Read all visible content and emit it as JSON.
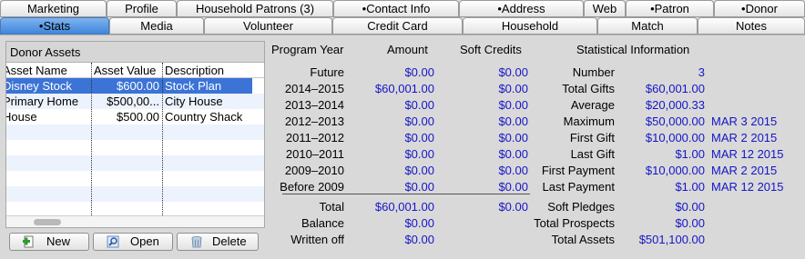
{
  "tabs_row1": [
    "Marketing",
    "Profile",
    "Household Patrons (3)",
    "•Contact Info",
    "•Address",
    "Web",
    "•Patron",
    "•Donor"
  ],
  "tabs_row2": [
    "•Stats",
    "Media",
    "Volunteer",
    "Credit Card",
    "Household",
    "Match",
    "Notes"
  ],
  "active_tab": "•Stats",
  "assets": {
    "title": "Donor Assets",
    "columns": [
      "Asset Name",
      "Asset Value",
      "Description"
    ],
    "rows": [
      {
        "name": "Disney Stock",
        "value": "$600.00",
        "description": "Stock Plan",
        "selected": true
      },
      {
        "name": "Primary Home",
        "value": "$500,00...",
        "description": "City House",
        "selected": false
      },
      {
        "name": "House",
        "value": "$500.00",
        "description": "Country Shack",
        "selected": false
      }
    ],
    "buttons": {
      "new": "New",
      "open": "Open",
      "delete": "Delete"
    }
  },
  "stats": {
    "headers": {
      "program_year": "Program Year",
      "amount": "Amount",
      "soft_credits": "Soft Credits",
      "statistical": "Statistical Information"
    },
    "years": [
      {
        "year": "Future",
        "amount": "$0.00",
        "soft": "$0.00"
      },
      {
        "year": "2014–2015",
        "amount": "$60,001.00",
        "soft": "$0.00"
      },
      {
        "year": "2013–2014",
        "amount": "$0.00",
        "soft": "$0.00"
      },
      {
        "year": "2012–2013",
        "amount": "$0.00",
        "soft": "$0.00"
      },
      {
        "year": "2011–2012",
        "amount": "$0.00",
        "soft": "$0.00"
      },
      {
        "year": "2010–2011",
        "amount": "$0.00",
        "soft": "$0.00"
      },
      {
        "year": "2009–2010",
        "amount": "$0.00",
        "soft": "$0.00"
      },
      {
        "year": "Before 2009",
        "amount": "$0.00",
        "soft": "$0.00"
      }
    ],
    "totals": [
      {
        "label": "Total",
        "amount": "$60,001.00",
        "soft": "$0.00"
      },
      {
        "label": "Balance",
        "amount": "$0.00",
        "soft": ""
      },
      {
        "label": "Written off",
        "amount": "$0.00",
        "soft": ""
      }
    ],
    "info": [
      {
        "label": "Number",
        "value": "3",
        "date": ""
      },
      {
        "label": "Total Gifts",
        "value": "$60,001.00",
        "date": ""
      },
      {
        "label": "Average",
        "value": "$20,000.33",
        "date": ""
      },
      {
        "label": "Maximum",
        "value": "$50,000.00",
        "date": "MAR 3 2015"
      },
      {
        "label": "First Gift",
        "value": "$10,000.00",
        "date": "MAR 2 2015"
      },
      {
        "label": "Last Gift",
        "value": "$1.00",
        "date": "MAR 12 2015"
      },
      {
        "label": "First Payment",
        "value": "$10,000.00",
        "date": "MAR 2 2015"
      },
      {
        "label": "Last Payment",
        "value": "$1.00",
        "date": "MAR 12 2015"
      }
    ],
    "info_totals": [
      {
        "label": "Soft Pledges",
        "value": "$0.00"
      },
      {
        "label": "Total Prospects",
        "value": "$0.00"
      },
      {
        "label": "Total Assets",
        "value": "$501,100.00"
      }
    ]
  }
}
